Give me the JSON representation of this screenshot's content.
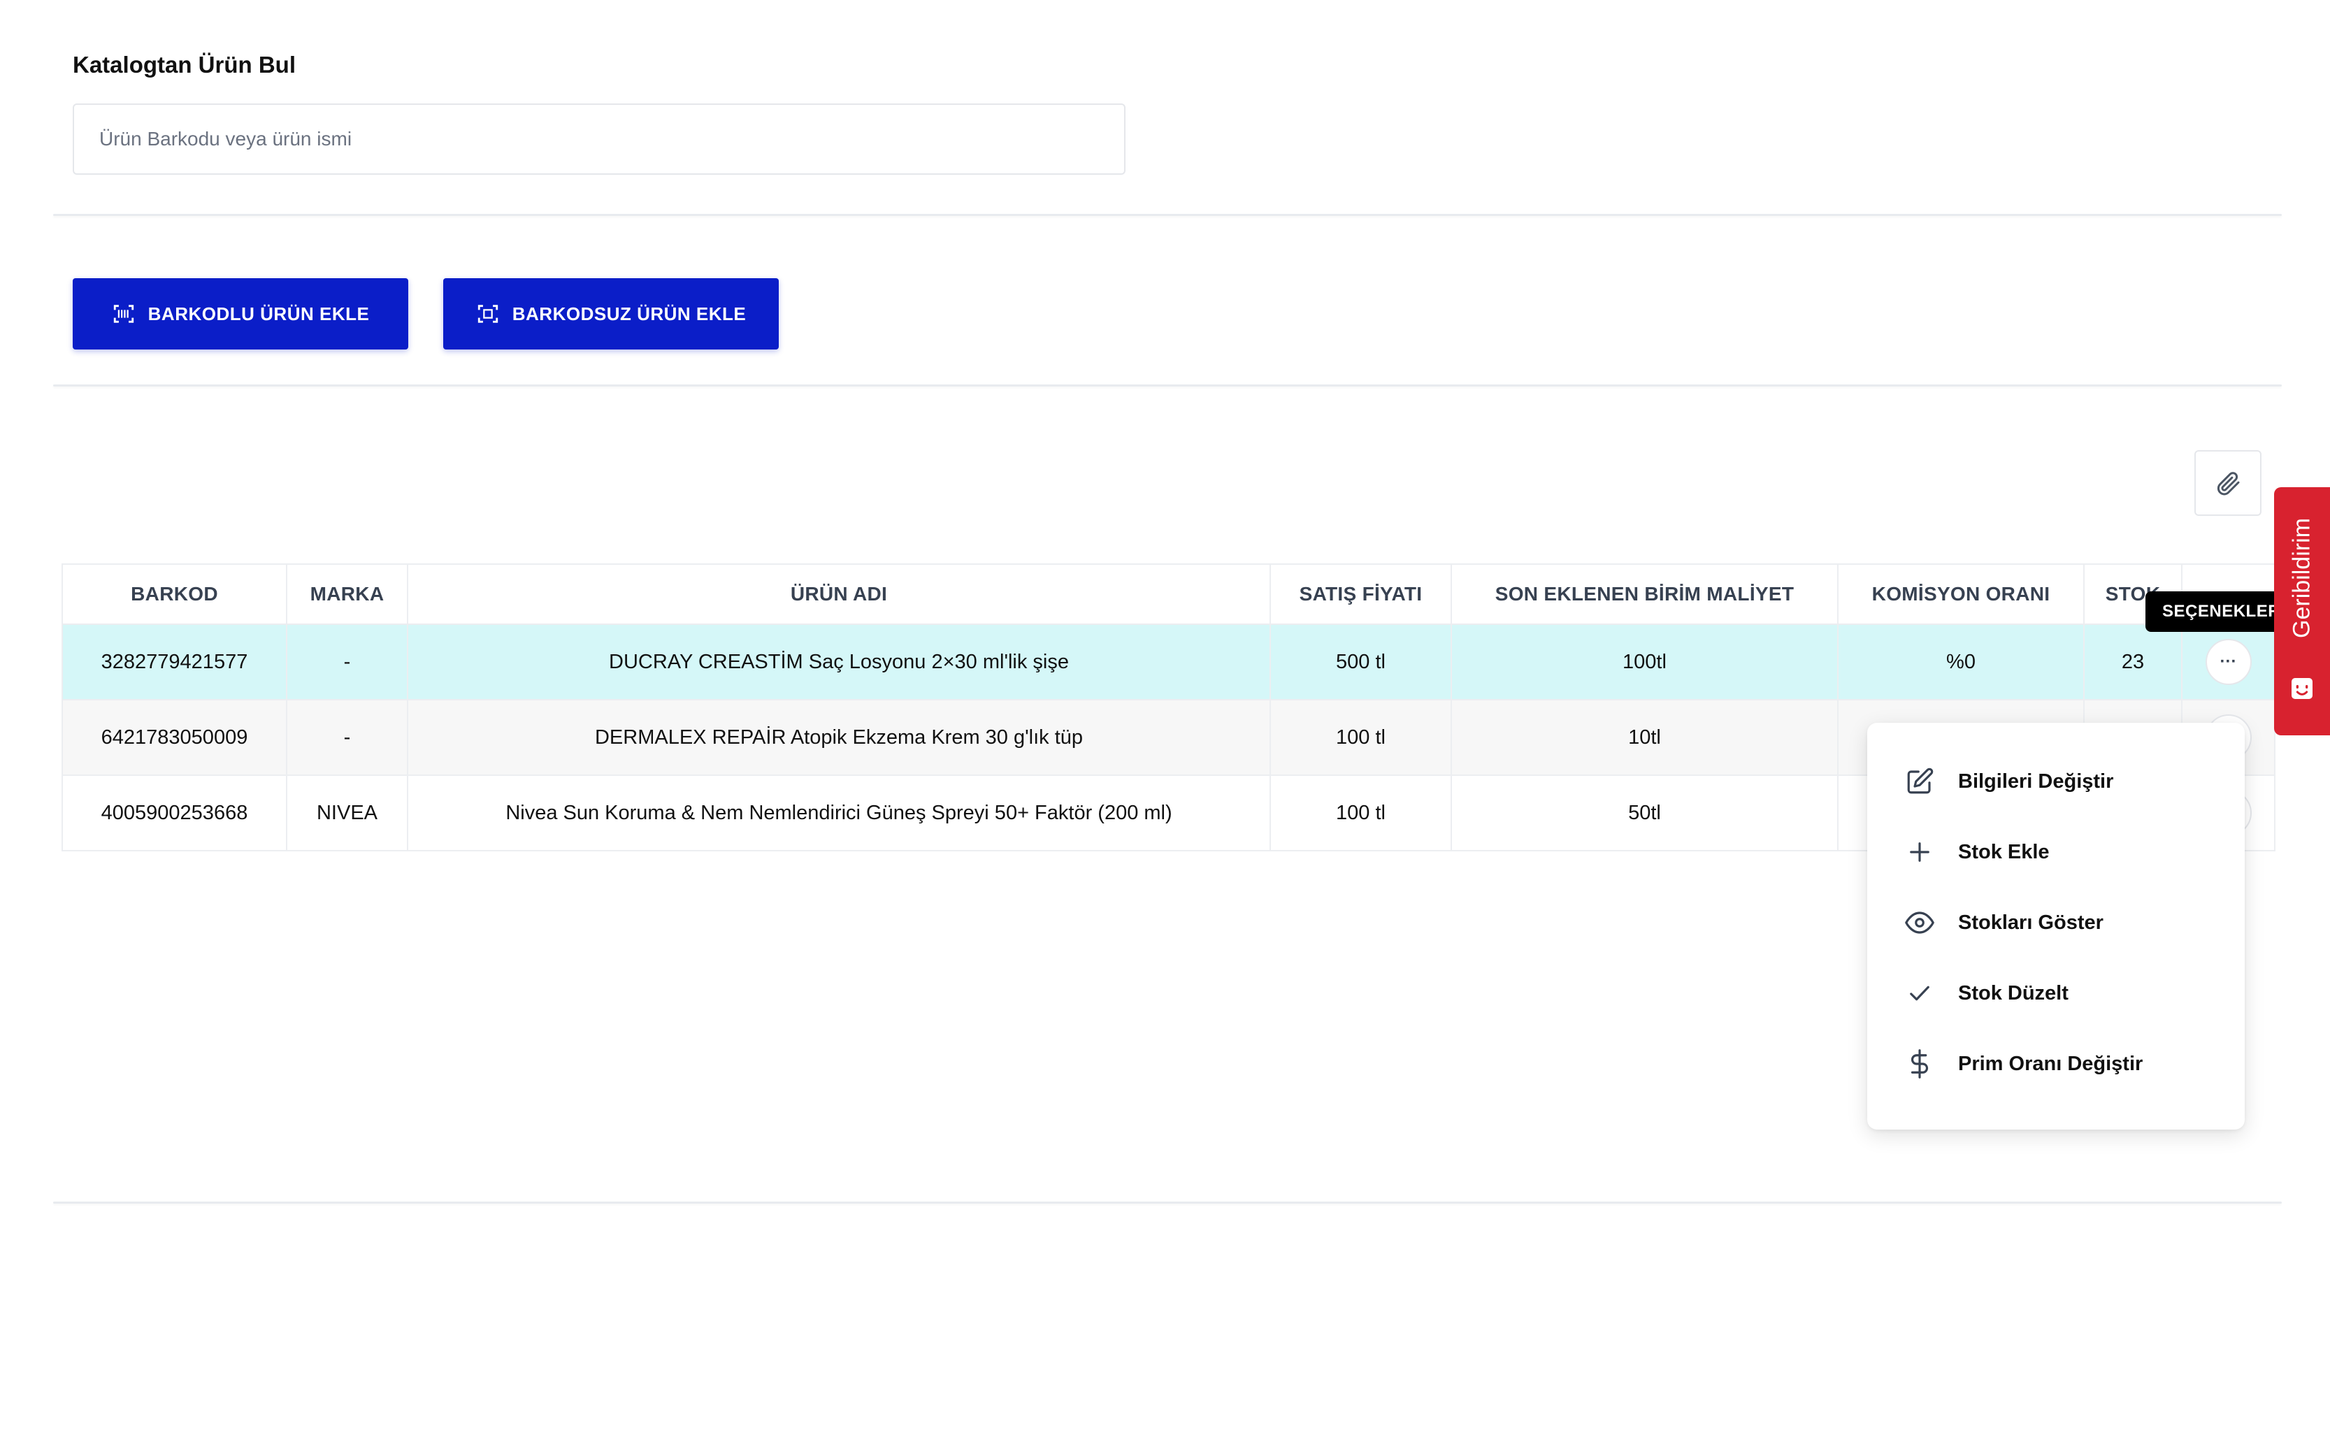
{
  "search": {
    "title": "Katalogtan Ürün Bul",
    "placeholder": "Ürün Barkodu veya ürün ismi",
    "value": ""
  },
  "actions": {
    "barcode_add": "BARKODLU ÜRÜN EKLE",
    "no_barcode_add": "BARKODSUZ ÜRÜN EKLE"
  },
  "table": {
    "headers": [
      "BARKOD",
      "MARKA",
      "ÜRÜN ADI",
      "SATIŞ FİYATI",
      "SON EKLENEN BİRİM MALİYET",
      "KOMİSYON ORANI",
      "STOK"
    ],
    "rows": [
      {
        "barkod": "3282779421577",
        "marka": "-",
        "urun_adi": "DUCRAY CREASTİM Saç Losyonu 2×30 ml'lik şişe",
        "satis_fiyati": "500 tl",
        "birim_maliyet": "100tl",
        "komisyon": "%0",
        "stok": "23"
      },
      {
        "barkod": "6421783050009",
        "marka": "-",
        "urun_adi": "DERMALEX REPAİR Atopik Ekzema Krem 30 g'lık tüp",
        "satis_fiyati": "100 tl",
        "birim_maliyet": "10tl",
        "komisyon": "",
        "stok": ""
      },
      {
        "barkod": "4005900253668",
        "marka": "NIVEA",
        "urun_adi": "Nivea Sun Koruma & Nem Nemlendirici Güneş Spreyi 50+ Faktör (200 ml)",
        "satis_fiyati": "100 tl",
        "birim_maliyet": "50tl",
        "komisyon": "",
        "stok": ""
      }
    ]
  },
  "tooltip": "SEÇENEKLER",
  "options_menu": {
    "items": [
      {
        "label": "Bilgileri Değiştir",
        "icon": "edit-icon"
      },
      {
        "label": "Stok Ekle",
        "icon": "plus-icon"
      },
      {
        "label": "Stokları Göster",
        "icon": "eye-icon"
      },
      {
        "label": "Stok Düzelt",
        "icon": "check-icon"
      },
      {
        "label": "Prim Oranı Değiştir",
        "icon": "dollar-icon"
      }
    ]
  },
  "feedback": {
    "label": "Geribildirim",
    "color": "#d8222f"
  },
  "colors": {
    "primary": "#0b1ec8",
    "row_highlight": "#d5f7f8"
  }
}
